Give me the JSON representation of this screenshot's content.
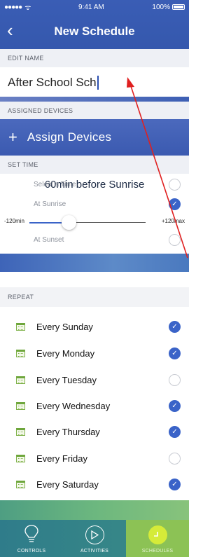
{
  "status_bar": {
    "signal": "●●●●● ",
    "wifi": "ᯤ",
    "time": "9:41 AM",
    "battery_pct": "100%"
  },
  "nav": {
    "back_glyph": "‹",
    "title": "New Schedule"
  },
  "edit_name": {
    "header": "EDIT NAME",
    "value": "After School Sch"
  },
  "assigned_devices": {
    "header": "ASSIGNED DEVICES",
    "plus_glyph": "+",
    "button_label": "Assign Devices"
  },
  "set_time": {
    "header": "SET TIME",
    "summary": "60min before Sunrise",
    "options": [
      {
        "label": "Select a Time",
        "selected": false
      },
      {
        "label": "At Sunrise",
        "selected": true
      },
      {
        "label": "At Sunset",
        "selected": false
      }
    ],
    "slider": {
      "min_label": "-120min",
      "max_label": "+120max",
      "value_min": -60
    }
  },
  "repeat": {
    "header": "REPEAT",
    "days": [
      {
        "label": "Every Sunday",
        "checked": true
      },
      {
        "label": "Every Monday",
        "checked": true
      },
      {
        "label": "Every Tuesday",
        "checked": false
      },
      {
        "label": "Every Wednesday",
        "checked": true
      },
      {
        "label": "Every Thursday",
        "checked": true
      },
      {
        "label": "Every Friday",
        "checked": false
      },
      {
        "label": "Every Saturday",
        "checked": true
      }
    ]
  },
  "tabbar": {
    "tabs": [
      {
        "label": "CONTROLS",
        "icon": "lightbulb-icon",
        "active": false
      },
      {
        "label": "ACTIVITIES",
        "icon": "play-icon",
        "active": false
      },
      {
        "label": "SCHEDULES",
        "icon": "clock-icon",
        "active": true
      }
    ]
  },
  "colors": {
    "primary_blue": "#3a5db5",
    "check_blue": "#3a63c8",
    "active_tab_green": "#8cc255"
  }
}
